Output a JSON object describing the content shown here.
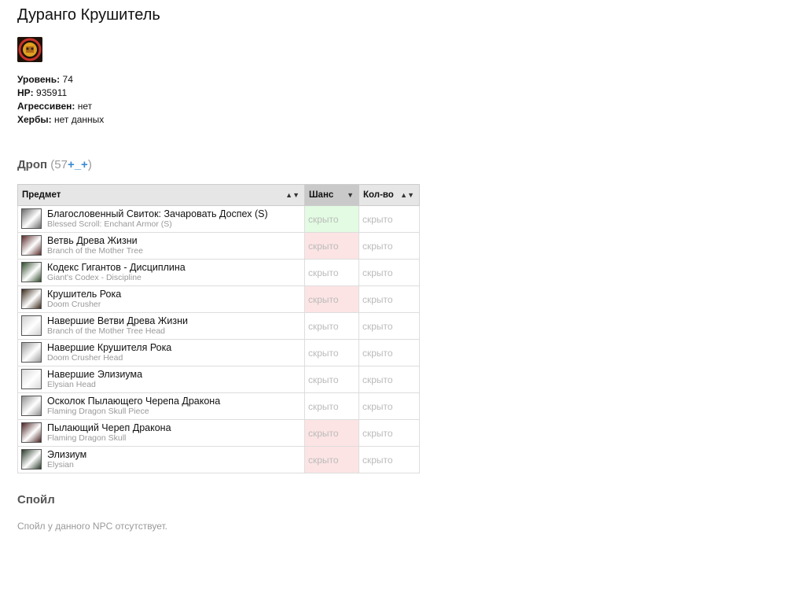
{
  "npc": {
    "name": "Дуранго Крушитель",
    "level_label": "Уровень:",
    "level": "74",
    "hp_label": "HP:",
    "hp": "935911",
    "aggr_label": "Агрессивен:",
    "aggr": "нет",
    "herbs_label": "Хербы:",
    "herbs": "нет данных"
  },
  "drop": {
    "title": "Дроп",
    "count_open": "(57",
    "plus_minus": "+_+",
    "count_close": ")",
    "columns": {
      "item": "Предмет",
      "chance": "Шанс",
      "qty": "Кол-во"
    },
    "rows": [
      {
        "name": "Благословенный Свиток: Зачаровать Доспех (S)",
        "en": "Blessed Scroll: Enchant Armor (S)",
        "chance": "скрыто",
        "qty": "скрыто",
        "chance_tint": "green",
        "icon": "scroll-icon",
        "icon_color": "#6a6a6a"
      },
      {
        "name": "Ветвь Древа Жизни",
        "en": "Branch of the Mother Tree",
        "chance": "скрыто",
        "qty": "скрыто",
        "chance_tint": "red",
        "icon": "branch-icon",
        "icon_color": "#5a2a2a"
      },
      {
        "name": "Кодекс Гигантов - Дисциплина",
        "en": "Giant's Codex - Discipline",
        "chance": "скрыто",
        "qty": "скрыто",
        "chance_tint": "none",
        "icon": "codex-icon",
        "icon_color": "#2f4a2a"
      },
      {
        "name": "Крушитель Рока",
        "en": "Doom Crusher",
        "chance": "скрыто",
        "qty": "скрыто",
        "chance_tint": "red",
        "icon": "weapon-icon",
        "icon_color": "#3a2a1a"
      },
      {
        "name": "Навершие Ветви Древа Жизни",
        "en": "Branch of the Mother Tree Head",
        "chance": "скрыто",
        "qty": "скрыто",
        "chance_tint": "none",
        "icon": "crystal-icon",
        "icon_color": "#cfcfcf"
      },
      {
        "name": "Навершие Крушителя Рока",
        "en": "Doom Crusher Head",
        "chance": "скрыто",
        "qty": "скрыто",
        "chance_tint": "none",
        "icon": "crystal-icon",
        "icon_color": "#9a9a9a"
      },
      {
        "name": "Навершие Элизиума",
        "en": "Elysian Head",
        "chance": "скрыто",
        "qty": "скрыто",
        "chance_tint": "none",
        "icon": "crystal-icon",
        "icon_color": "#d8d8d8"
      },
      {
        "name": "Осколок Пылающего Черепа Дракона",
        "en": "Flaming Dragon Skull Piece",
        "chance": "скрыто",
        "qty": "скрыто",
        "chance_tint": "none",
        "icon": "crystal-icon",
        "icon_color": "#8f8f8f"
      },
      {
        "name": "Пылающий Череп Дракона",
        "en": "Flaming Dragon Skull",
        "chance": "скрыто",
        "qty": "скрыто",
        "chance_tint": "red",
        "icon": "skull-weapon-icon",
        "icon_color": "#4a2222"
      },
      {
        "name": "Элизиум",
        "en": "Elysian",
        "chance": "скрыто",
        "qty": "скрыто",
        "chance_tint": "red",
        "icon": "sword-icon",
        "icon_color": "#2a3a2a"
      }
    ]
  },
  "spoil": {
    "title": "Спойл",
    "text": "Спойл у данного NPC отсутствует."
  }
}
